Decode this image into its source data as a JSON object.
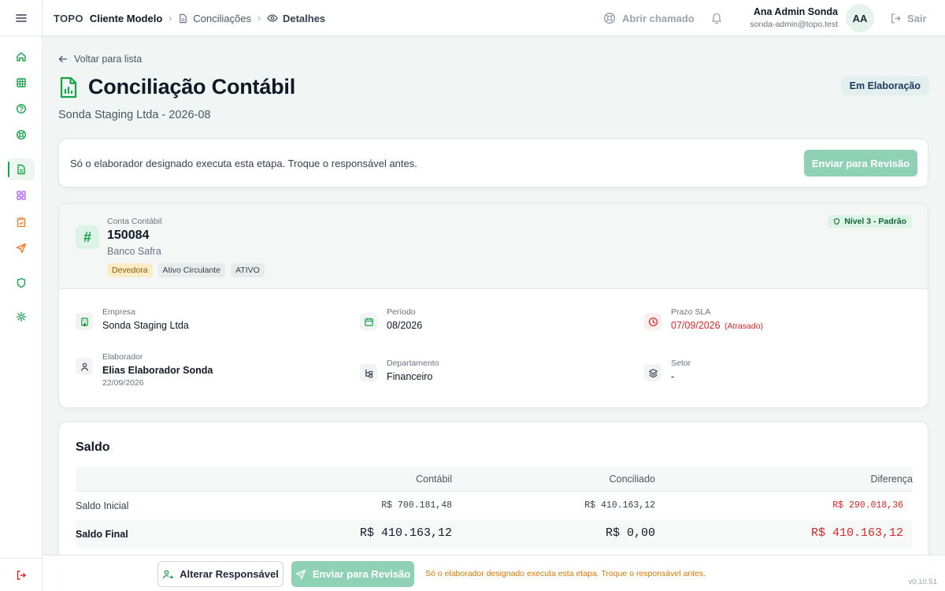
{
  "sidebar": {
    "items": [
      {
        "name": "home-icon",
        "color": "#16a34a"
      },
      {
        "name": "table-icon",
        "color": "#16a34a"
      },
      {
        "name": "help-icon",
        "color": "#16a34a"
      },
      {
        "name": "support-icon",
        "color": "#16a34a"
      },
      {
        "name": "document-icon",
        "color": "#16a34a",
        "active": true
      },
      {
        "name": "grid-icon",
        "color": "#a855f7"
      },
      {
        "name": "clipboard-icon",
        "color": "#f97316"
      },
      {
        "name": "send-icon",
        "color": "#f97316"
      },
      {
        "name": "shield-icon",
        "color": "#16a34a"
      },
      {
        "name": "settings-icon",
        "color": "#16a34a"
      }
    ],
    "logout_icon": "logout-icon"
  },
  "header": {
    "brand": "TOPO",
    "client": "Cliente Modelo",
    "breadcrumb_1": "Conciliações",
    "breadcrumb_2": "Detalhes",
    "ticket": "Abrir chamado",
    "user_name": "Ana Admin Sonda",
    "user_email": "sonda-admin@topo.test",
    "avatar": "AA",
    "logout": "Sair"
  },
  "page": {
    "back": "Voltar para lista",
    "title": "Conciliação Contábil",
    "subtitle": "Sonda Staging Ltda - 2026-08",
    "status": "Em Elaboração"
  },
  "notice": {
    "text": "Só o elaborador designado executa esta etapa. Troque o responsável antes.",
    "button": "Enviar para Revisão"
  },
  "account": {
    "label": "Conta Contábil",
    "number": "150084",
    "name": "Banco Safra",
    "tags": [
      "Devedora",
      "Ativo Circulante",
      "ATIVO"
    ],
    "level": "Nível 3 - Padrão"
  },
  "info": {
    "empresa_label": "Empresa",
    "empresa": "Sonda Staging Ltda",
    "periodo_label": "Período",
    "periodo": "08/2026",
    "sla_label": "Prazo SLA",
    "sla": "07/09/2026",
    "sla_status": "(Atrasado)",
    "elaborador_label": "Elaborador",
    "elaborador": "Elias Elaborador Sonda",
    "elaborador_date": "22/09/2026",
    "departamento_label": "Departamento",
    "departamento": "Financeiro",
    "setor_label": "Setor",
    "setor": "-"
  },
  "saldo": {
    "title": "Saldo",
    "columns": [
      "Contábil",
      "Conciliado",
      "Diferença"
    ],
    "rows": [
      {
        "label": "Saldo Inicial",
        "contabil": "R$ 700.181,48",
        "conciliado": "R$ 410.163,12",
        "diferenca": "R$ 290.018,36"
      },
      {
        "label": "Saldo Final",
        "contabil": "R$ 410.163,12",
        "conciliado": "R$ 0,00",
        "diferenca": "R$ 410.163,12"
      }
    ]
  },
  "bottom": {
    "change_owner": "Alterar Responsável",
    "send": "Enviar para Revisão",
    "warning": "Só o elaborador designado executa esta etapa. Troque o responsável antes.",
    "version": "v0.10.51"
  },
  "colors": {
    "accent": "#16a34a",
    "primary_disabled": "#8fd1b5",
    "danger": "#dc2626",
    "warning": "#d97706"
  }
}
